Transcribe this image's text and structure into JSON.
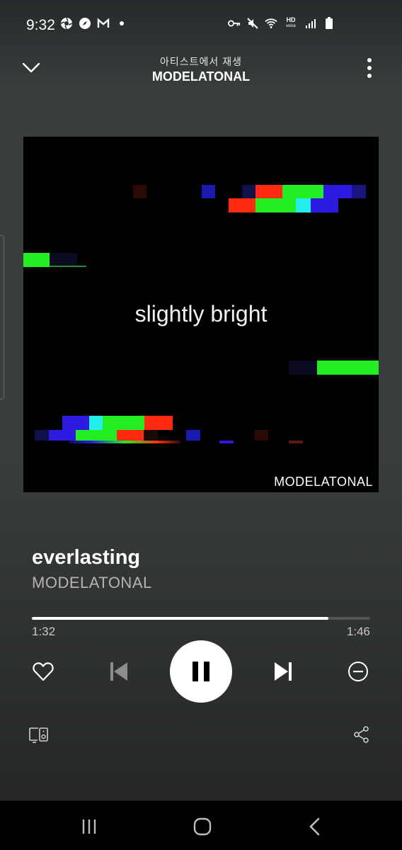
{
  "status_bar": {
    "time": "9:32",
    "left_icons": [
      "camera-aperture-icon",
      "compass-icon",
      "gmail-icon",
      "dot-icon"
    ],
    "right_icons": [
      "key-icon",
      "mute-icon",
      "wifi-icon",
      "hd-voice-icon",
      "signal-icon",
      "battery-icon"
    ],
    "hd_label": "HD",
    "voice_label": "voice"
  },
  "header": {
    "context_label": "아티스트에서 재생",
    "title": "MODELATONAL"
  },
  "album_art": {
    "text": "slightly bright",
    "brand": "MODELATONAL"
  },
  "track": {
    "title": "everlasting",
    "artist": "MODELATONAL"
  },
  "playback": {
    "elapsed": "1:32",
    "duration": "1:46",
    "progress_fraction": 0.876,
    "state": "playing"
  },
  "colors": {
    "background_top": "#3a3d3e",
    "accent": "#ffffff",
    "progress_track": "#535353"
  }
}
